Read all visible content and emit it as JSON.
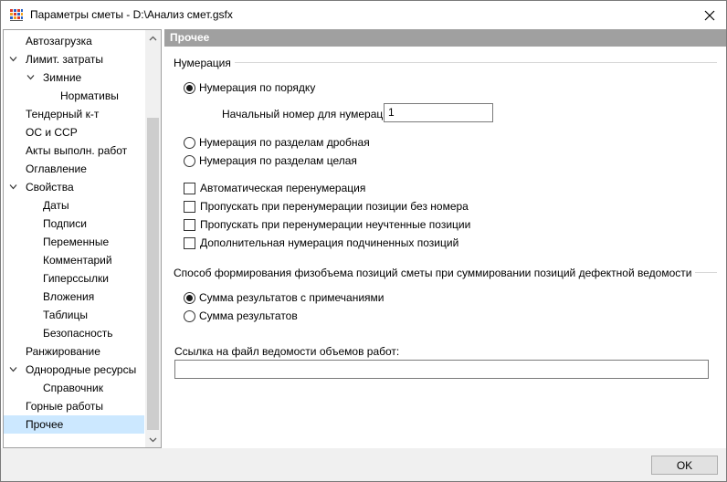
{
  "window": {
    "title": "Параметры сметы - D:\\Анализ смет.gsfx"
  },
  "tree": {
    "items": [
      {
        "label": "Автозагрузка",
        "level": 0,
        "expanded": null,
        "selected": false
      },
      {
        "label": "Лимит. затраты",
        "level": 0,
        "expanded": true,
        "selected": false
      },
      {
        "label": "Зимние",
        "level": 1,
        "expanded": true,
        "selected": false
      },
      {
        "label": "Нормативы",
        "level": 2,
        "expanded": null,
        "selected": false
      },
      {
        "label": "Тендерный к-т",
        "level": 0,
        "expanded": null,
        "selected": false
      },
      {
        "label": "ОС и ССР",
        "level": 0,
        "expanded": null,
        "selected": false
      },
      {
        "label": "Акты выполн. работ",
        "level": 0,
        "expanded": null,
        "selected": false
      },
      {
        "label": "Оглавление",
        "level": 0,
        "expanded": null,
        "selected": false
      },
      {
        "label": "Свойства",
        "level": 0,
        "expanded": true,
        "selected": false
      },
      {
        "label": "Даты",
        "level": 1,
        "expanded": null,
        "selected": false
      },
      {
        "label": "Подписи",
        "level": 1,
        "expanded": null,
        "selected": false
      },
      {
        "label": "Переменные",
        "level": 1,
        "expanded": null,
        "selected": false
      },
      {
        "label": "Комментарий",
        "level": 1,
        "expanded": null,
        "selected": false
      },
      {
        "label": "Гиперссылки",
        "level": 1,
        "expanded": null,
        "selected": false
      },
      {
        "label": "Вложения",
        "level": 1,
        "expanded": null,
        "selected": false
      },
      {
        "label": "Таблицы",
        "level": 1,
        "expanded": null,
        "selected": false
      },
      {
        "label": "Безопасность",
        "level": 1,
        "expanded": null,
        "selected": false
      },
      {
        "label": "Ранжирование",
        "level": 0,
        "expanded": null,
        "selected": false
      },
      {
        "label": "Однородные ресурсы",
        "level": 0,
        "expanded": true,
        "selected": false
      },
      {
        "label": "Справочник",
        "level": 1,
        "expanded": null,
        "selected": false
      },
      {
        "label": "Горные работы",
        "level": 0,
        "expanded": null,
        "selected": false
      },
      {
        "label": "Прочее",
        "level": 0,
        "expanded": null,
        "selected": true
      }
    ]
  },
  "panel": {
    "header": "Прочее",
    "numbering": {
      "title": "Нумерация",
      "options": [
        {
          "label": "Нумерация по порядку",
          "checked": true
        },
        {
          "label": "Нумерация по разделам дробная",
          "checked": false
        },
        {
          "label": "Нумерация по разделам целая",
          "checked": false
        }
      ],
      "start_label": "Начальный номер для нумерации:",
      "start_value": "1",
      "checkboxes": [
        {
          "label": "Автоматическая перенумерация",
          "checked": false
        },
        {
          "label": "Пропускать при перенумерации позиции без номера",
          "checked": false
        },
        {
          "label": "Пропускать при перенумерации неучтенные позиции",
          "checked": false
        },
        {
          "label": "Дополнительная нумерация подчиненных позиций",
          "checked": false
        }
      ]
    },
    "volume": {
      "title": "Способ формирования физобъема позиций сметы при суммировании позиций дефектной ведомости",
      "options": [
        {
          "label": "Сумма результатов с примечаниями",
          "checked": true
        },
        {
          "label": "Сумма результатов",
          "checked": false
        }
      ]
    },
    "link": {
      "label": "Ссылка на файл ведомости объемов работ:",
      "value": ""
    }
  },
  "footer": {
    "ok_label": "OK"
  },
  "colors": {
    "selection": "#cce8ff",
    "header_bg": "#a0a0a0",
    "footer_bg": "#f0f0f0"
  }
}
